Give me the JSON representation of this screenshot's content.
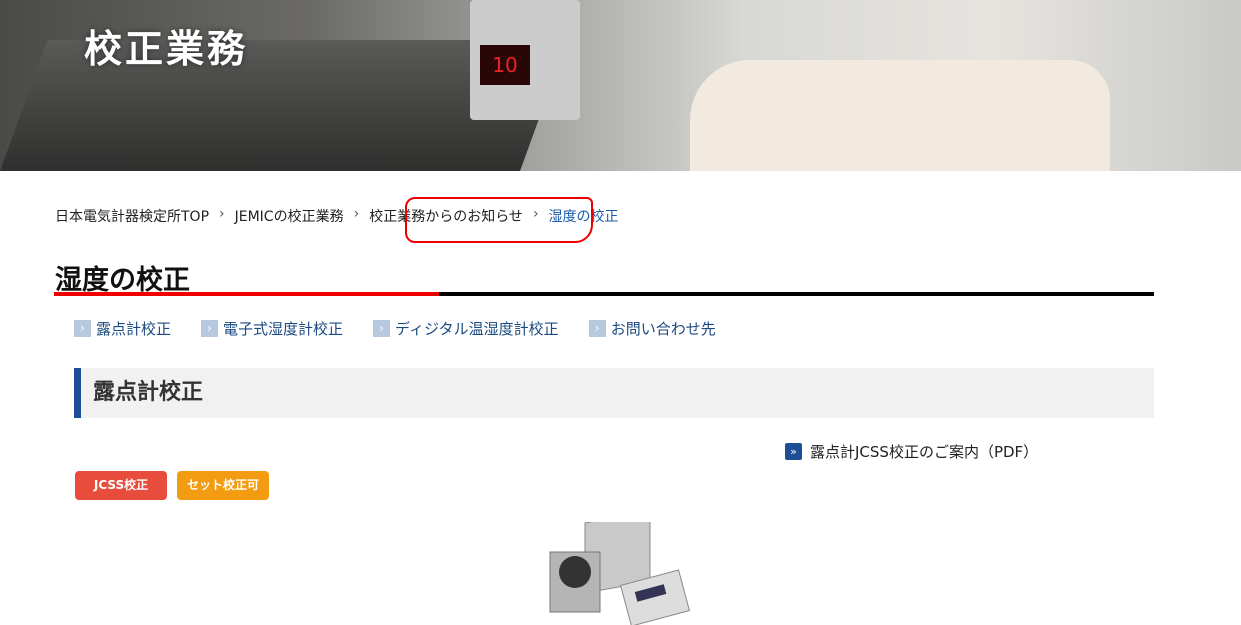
{
  "hero": {
    "title": "校正業務",
    "display_reading": "10"
  },
  "breadcrumb": [
    {
      "label": "日本電気計器検定所TOP"
    },
    {
      "label": "JEMICの校正業務"
    },
    {
      "label": "校正業務からのお知らせ"
    },
    {
      "label": "湿度の校正"
    }
  ],
  "breadcrumb_sep": "›",
  "page_title": "湿度の校正",
  "anchors": [
    {
      "label": "露点計校正"
    },
    {
      "label": "電子式湿度計校正"
    },
    {
      "label": "ディジタル温湿度計校正"
    },
    {
      "label": "お問い合わせ先"
    }
  ],
  "section": {
    "title": "露点計校正",
    "pdf_link": "露点計JCSS校正のご案内（PDF）",
    "badges": [
      "JCSS校正",
      "セット校正可"
    ]
  },
  "colors": {
    "accent_red": "#e00000",
    "nav_blue": "#1c4f97",
    "badge_red": "#e74c3c",
    "badge_orange": "#f39c12"
  }
}
